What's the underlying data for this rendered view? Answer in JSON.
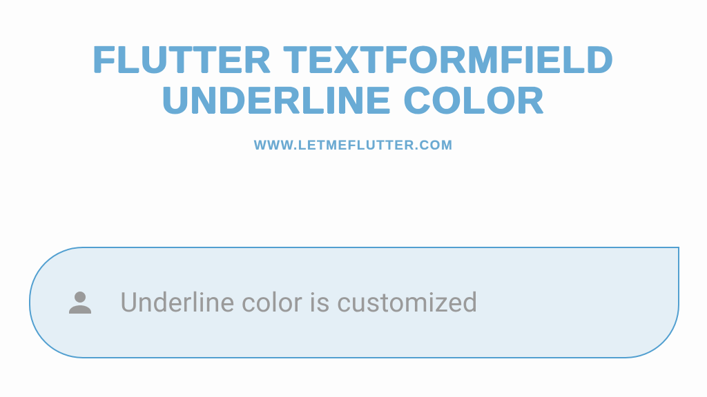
{
  "title_line1": "FLUTTER TEXTFORMFIELD",
  "title_line2": "UNDERLINE COLOR",
  "subtitle": "WWW.LETMEFLUTTER.COM",
  "field": {
    "placeholder": "Underline color is customized"
  },
  "colors": {
    "accent": "#6aa9d1",
    "border": "#519fd0",
    "field_bg": "#e4eff6",
    "icon": "#9a9a9a",
    "placeholder": "#9a9a9a"
  }
}
